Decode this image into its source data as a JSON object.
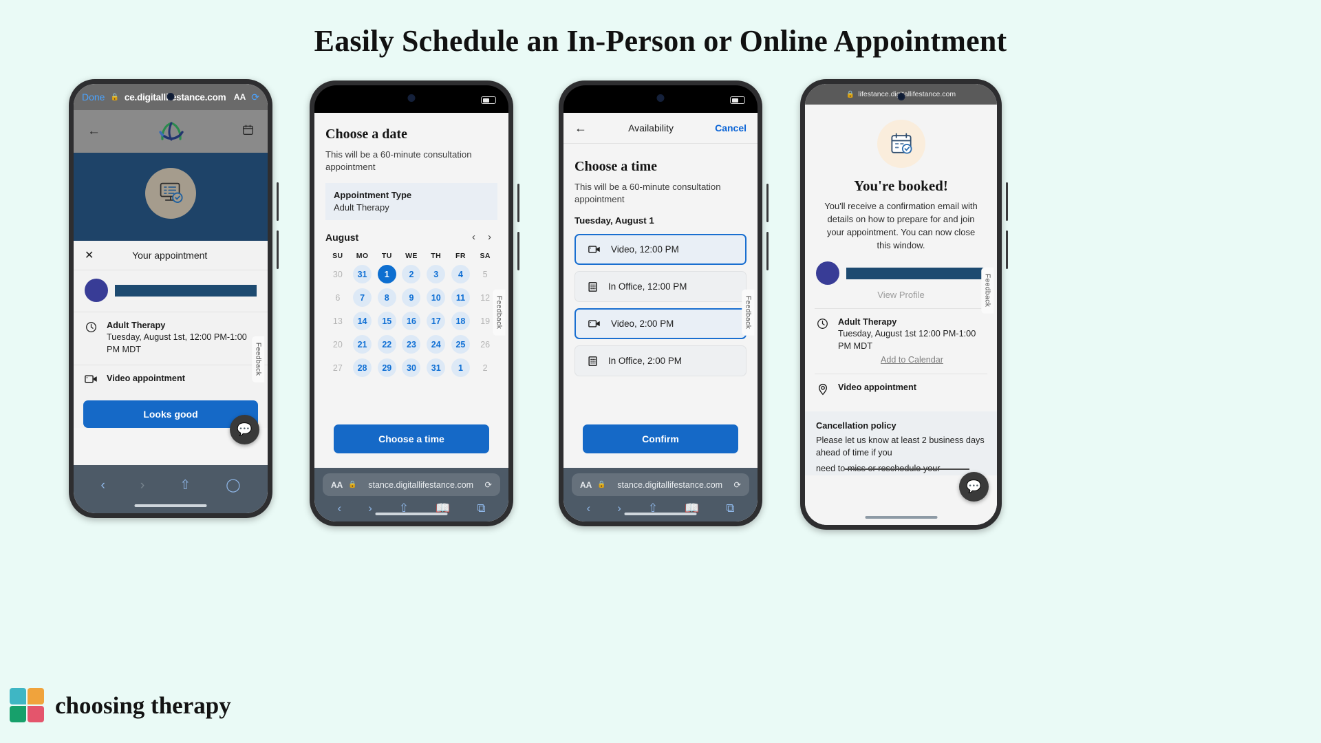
{
  "headline": "Easily Schedule an In-Person or Online Appointment",
  "brand": {
    "name": "choosing therapy"
  },
  "feedback_tab": "Feedback",
  "phone1": {
    "browser": {
      "done": "Done",
      "lock": "🔒",
      "url": "ce.digitallifestance.com",
      "aa": "AA",
      "reload": "⟳"
    },
    "app": {
      "back": "←",
      "calendar_icon": "calendar-icon"
    },
    "card": {
      "close": "✕",
      "title": "Your appointment",
      "provider_redacted": "",
      "appt_type": "Adult Therapy",
      "appt_time": "Tuesday, August 1st, 12:00 PM-1:00 PM MDT",
      "modality": "Video appointment",
      "cta": "Looks good"
    },
    "nav": {
      "back": "‹",
      "forward": "›",
      "share": "⇧",
      "tabs": "⧉"
    }
  },
  "phone2": {
    "title": "Choose a date",
    "subtitle": "This will be a 60-minute consultation appointment",
    "type_label": "Appointment Type",
    "type_value": "Adult Therapy",
    "month": "August",
    "prev": "‹",
    "next": "›",
    "weekdays": [
      "SU",
      "MO",
      "TU",
      "WE",
      "TH",
      "FR",
      "SA"
    ],
    "weeks": [
      [
        {
          "d": "30",
          "s": "off"
        },
        {
          "d": "31",
          "s": "avail"
        },
        {
          "d": "1",
          "s": "sel"
        },
        {
          "d": "2",
          "s": "avail"
        },
        {
          "d": "3",
          "s": "avail"
        },
        {
          "d": "4",
          "s": "avail"
        },
        {
          "d": "5",
          "s": "off"
        }
      ],
      [
        {
          "d": "6",
          "s": "off"
        },
        {
          "d": "7",
          "s": "avail"
        },
        {
          "d": "8",
          "s": "avail"
        },
        {
          "d": "9",
          "s": "avail"
        },
        {
          "d": "10",
          "s": "avail"
        },
        {
          "d": "11",
          "s": "avail"
        },
        {
          "d": "12",
          "s": "off"
        }
      ],
      [
        {
          "d": "13",
          "s": "off"
        },
        {
          "d": "14",
          "s": "avail"
        },
        {
          "d": "15",
          "s": "avail"
        },
        {
          "d": "16",
          "s": "avail"
        },
        {
          "d": "17",
          "s": "avail"
        },
        {
          "d": "18",
          "s": "avail"
        },
        {
          "d": "19",
          "s": "off"
        }
      ],
      [
        {
          "d": "20",
          "s": "off"
        },
        {
          "d": "21",
          "s": "avail"
        },
        {
          "d": "22",
          "s": "avail"
        },
        {
          "d": "23",
          "s": "avail"
        },
        {
          "d": "24",
          "s": "avail"
        },
        {
          "d": "25",
          "s": "avail"
        },
        {
          "d": "26",
          "s": "off"
        }
      ],
      [
        {
          "d": "27",
          "s": "off"
        },
        {
          "d": "28",
          "s": "avail"
        },
        {
          "d": "29",
          "s": "avail"
        },
        {
          "d": "30",
          "s": "avail"
        },
        {
          "d": "31",
          "s": "avail"
        },
        {
          "d": "1",
          "s": "avail"
        },
        {
          "d": "2",
          "s": "off"
        }
      ]
    ],
    "cta": "Choose a time",
    "browser": {
      "aa": "AA",
      "url": "stance.digitallifestance.com",
      "reload": "⟳"
    }
  },
  "phone3": {
    "nav": {
      "back": "←",
      "title": "Availability",
      "cancel": "Cancel"
    },
    "title": "Choose a time",
    "subtitle": "This will be a 60-minute consultation appointment",
    "date": "Tuesday, August 1",
    "slots": [
      {
        "icon": "video-icon",
        "label": "Video, 12:00 PM",
        "selected": true
      },
      {
        "icon": "building-icon",
        "label": "In Office, 12:00 PM",
        "selected": false
      },
      {
        "icon": "video-icon",
        "label": "Video, 2:00 PM",
        "selected": true
      },
      {
        "icon": "building-icon",
        "label": "In Office, 2:00 PM",
        "selected": false
      }
    ],
    "cta": "Confirm",
    "browser": {
      "aa": "AA",
      "url": "stance.digitallifestance.com",
      "reload": "⟳"
    }
  },
  "phone4": {
    "browser": {
      "lock": "🔒",
      "url": "lifestance.digitallifestance.com"
    },
    "title": "You're booked!",
    "body": "You'll receive a confirmation email with details on how to prepare for and join your appointment. You can now close this window.",
    "view_profile": "View Profile",
    "appt_type": "Adult Therapy",
    "appt_time": "Tuesday, August 1st 12:00 PM-1:00 PM MDT",
    "add_to_calendar": "Add to Calendar",
    "modality": "Video appointment",
    "policy_title": "Cancellation policy",
    "policy_body_1": "Please let us know at least 2 business days ahead of time if you",
    "policy_body_2": "need to miss or reschedule your"
  },
  "colors": {
    "background": "#eafaf6",
    "primary_blue": "#1569c7",
    "link_blue": "#0b64d6",
    "hero_navy": "#1e4368",
    "avatar_purple": "#383c96"
  }
}
